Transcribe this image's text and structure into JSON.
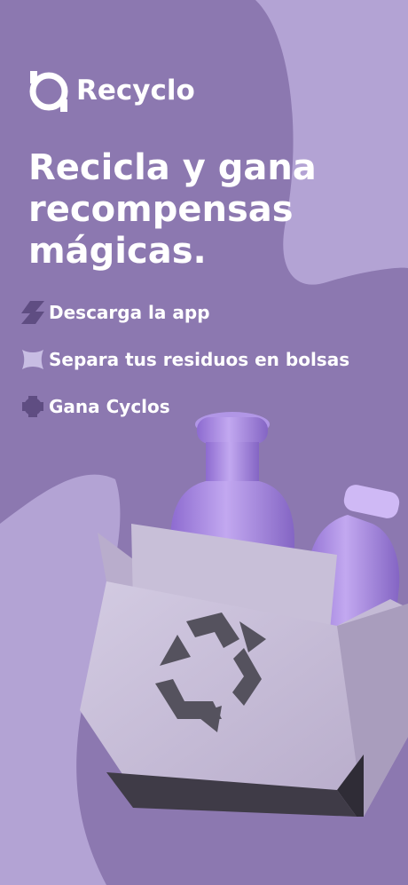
{
  "brand": {
    "name": "Recyclo"
  },
  "headline": {
    "line1": "Recicla y gana",
    "line2": "recompensas",
    "line3": "mágicas."
  },
  "steps": [
    {
      "label": "Descarga la app",
      "icon": "download-step-icon"
    },
    {
      "label": "Separa tus residuos en bolsas",
      "icon": "bags-step-icon"
    },
    {
      "label": "Gana Cyclos",
      "icon": "reward-step-icon"
    }
  ],
  "colors": {
    "background_light": "#b3a3d4",
    "background_dark": "#8c78b0",
    "text": "#ffffff",
    "bottle": "#a98ae0",
    "box": "#c6bcd8",
    "recycle_symbol": "#55525e"
  }
}
